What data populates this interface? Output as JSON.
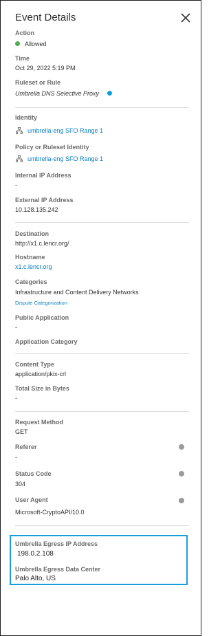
{
  "panel": {
    "title": "Event Details",
    "close_icon": "close-icon"
  },
  "action": {
    "label": "Action",
    "value": "Allowed",
    "status_color": "#4caf50"
  },
  "time": {
    "label": "Time",
    "value": "Oct 29, 2022 5:19 PM"
  },
  "ruleset": {
    "label": "Ruleset or Rule",
    "value": "Umbrella DNS Selective Proxy",
    "info_color": "#0a9fd8"
  },
  "identity": {
    "label": "Identity",
    "value": "umbrella-eng SFO Range 1",
    "icon": "network-icon"
  },
  "policy_identity": {
    "label": "Policy or Ruleset Identity",
    "value": "umbrella-eng SFO Range 1",
    "icon": "network-icon"
  },
  "internal_ip": {
    "label": "Internal IP Address",
    "value": "-"
  },
  "external_ip": {
    "label": "External IP Address",
    "value": "10.128.135.242"
  },
  "destination": {
    "label": "Destination",
    "value": "http://x1.c.lencr.org/"
  },
  "hostname": {
    "label": "Hostname",
    "value": "x1.c.lencr.org"
  },
  "categories": {
    "label": "Categories",
    "value": "Infrastructure and Content Delivery Networks",
    "dispute_link": "Dispute Categorization"
  },
  "public_application": {
    "label": "Public Application",
    "value": "-"
  },
  "application_category": {
    "label": "Application Category"
  },
  "content_type": {
    "label": "Content Type",
    "value": "application/pkix-crl"
  },
  "total_size": {
    "label": "Total Size in Bytes",
    "value": "-"
  },
  "request_method": {
    "label": "Request Method",
    "value": "GET"
  },
  "referer": {
    "label": "Referer",
    "value": "-"
  },
  "status_code": {
    "label": "Status Code",
    "value": "304"
  },
  "user_agent": {
    "label": "User Agent",
    "value": "Microsoft-CryptoAPI/10.0"
  },
  "egress": {
    "ip_label": "Umbrella Egress IP Address",
    "ip_value": "198.0.2.108",
    "dc_label": "Umbrella Egress Data Center",
    "dc_value": "Palo Alto, US",
    "highlight_color": "#1a9ed9"
  },
  "colors": {
    "link": "#0a7fc1",
    "label": "#6a6a6a"
  }
}
